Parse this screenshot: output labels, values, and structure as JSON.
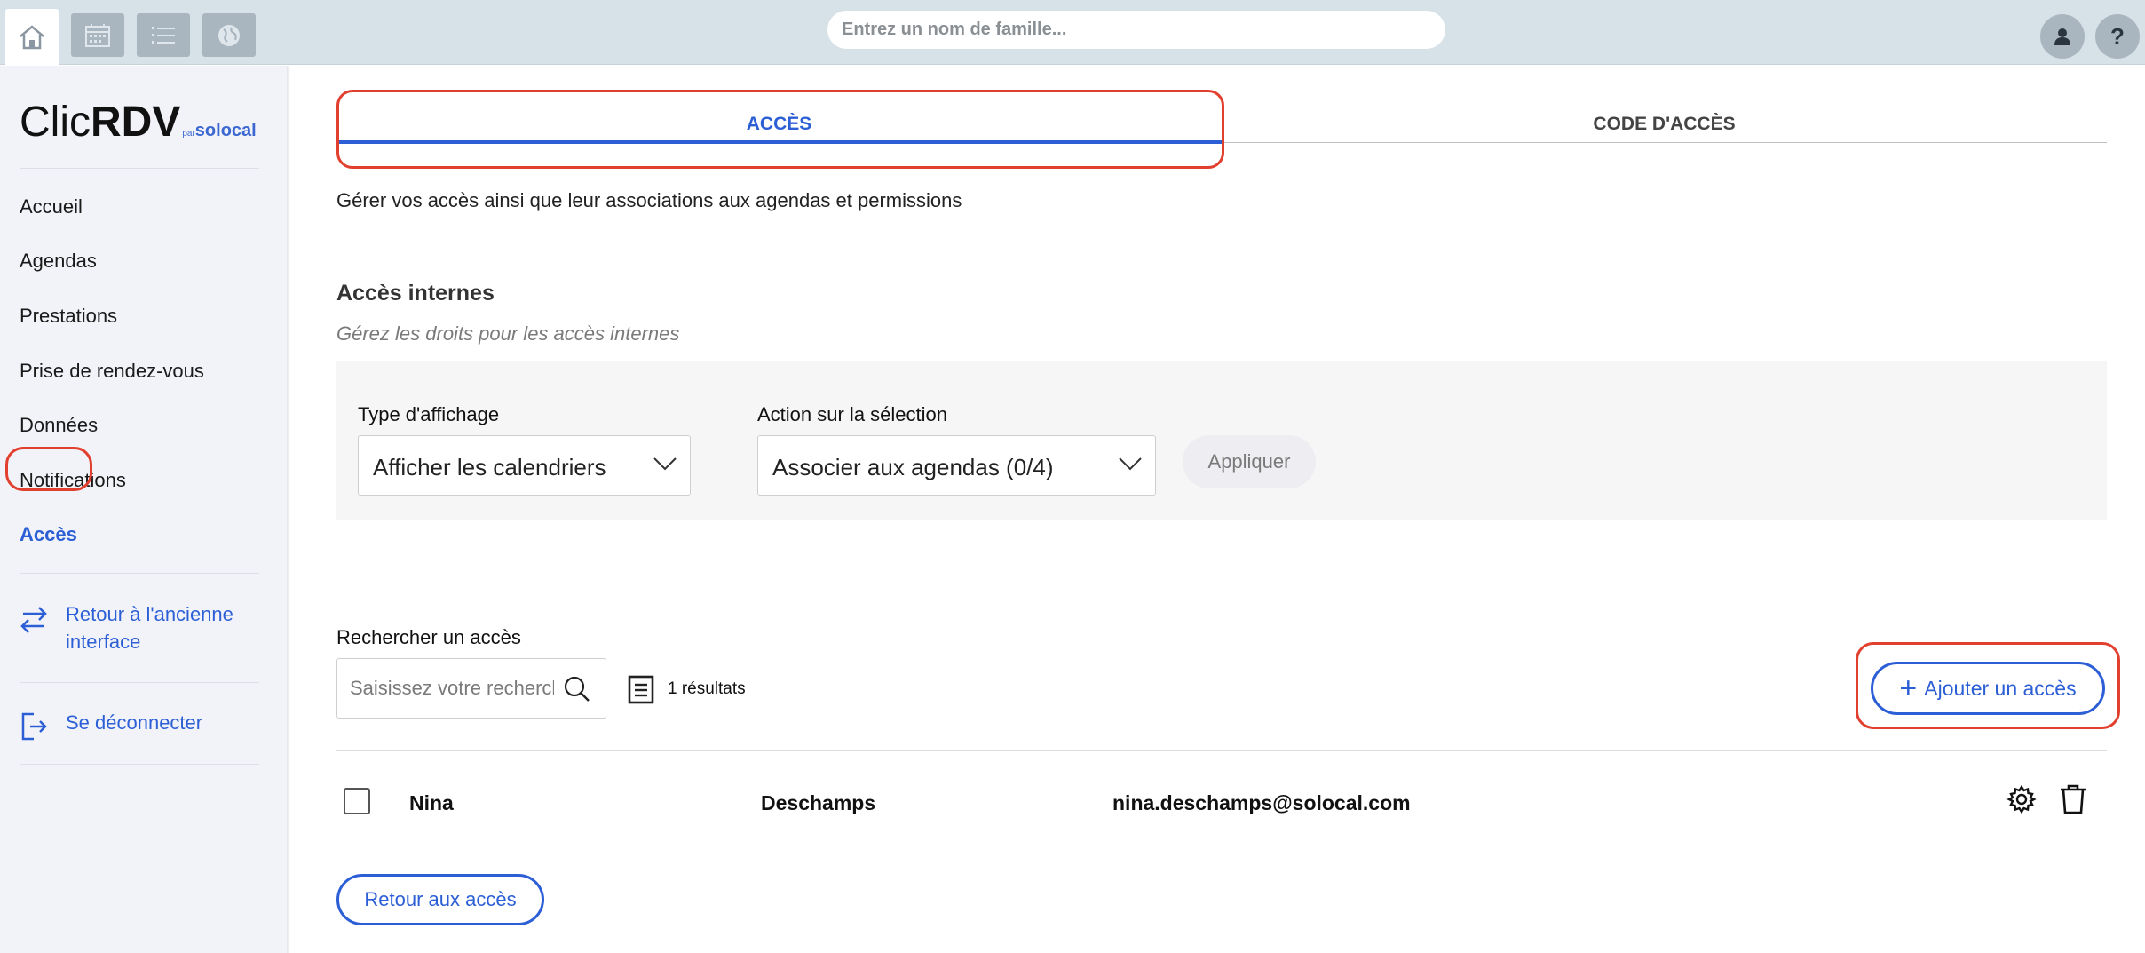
{
  "topbar": {
    "search_placeholder": "Entrez un nom de famille...",
    "icons": [
      "home-icon",
      "calendar-icon",
      "list-icon",
      "globe-icon",
      "user-icon",
      "help-icon"
    ]
  },
  "sidebar": {
    "logo": {
      "clic": "Clic",
      "rdv": "RDV",
      "par": "par",
      "solocal": "solocal"
    },
    "items": [
      {
        "label": "Accueil"
      },
      {
        "label": "Agendas"
      },
      {
        "label": "Prestations"
      },
      {
        "label": "Prise de rendez-vous"
      },
      {
        "label": "Données"
      },
      {
        "label": "Notifications"
      },
      {
        "label": "Accès",
        "active": true
      }
    ],
    "old_interface_line1": "Retour à l'ancienne",
    "old_interface_line2": "interface",
    "logout": "Se déconnecter"
  },
  "tabs": [
    {
      "label": "ACCÈS",
      "active": true
    },
    {
      "label": "CODE D'ACCÈS",
      "active": false
    }
  ],
  "description": "Gérer vos accès ainsi que leur associations aux agendas et permissions",
  "section": {
    "title": "Accès internes",
    "subtitle": "Gérez les droits pour les accès internes"
  },
  "filters": {
    "display_type_label": "Type d'affichage",
    "display_type_value": "Afficher les calendriers",
    "action_label": "Action sur la sélection",
    "action_value": "Associer aux agendas (0/4)",
    "apply_label": "Appliquer"
  },
  "search": {
    "label": "Rechercher un accès",
    "placeholder": "Saisissez votre recherche",
    "results": "1 résultats"
  },
  "add_button": "Ajouter un accès",
  "table": {
    "rows": [
      {
        "first_name": "Nina",
        "last_name": "Deschamps",
        "email": "nina.deschamps@solocal.com"
      }
    ]
  },
  "back_button": "Retour aux accès",
  "colors": {
    "accent": "#2c5fd6",
    "highlight": "#e2402f",
    "topbar": "#d7e1e8",
    "sidebar": "#f1f3f8"
  }
}
